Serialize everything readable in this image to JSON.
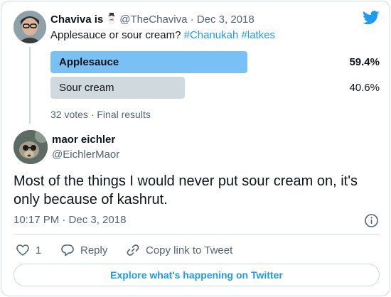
{
  "parent_tweet": {
    "author_name": "Chaviva is",
    "author_emoji": "snowman-emoji",
    "handle": "@TheChaviva",
    "separator": "·",
    "date": "Dec 3, 2018",
    "text_prefix": "Applesauce or sour cream? ",
    "hashtags": [
      "#Chanukah",
      "#latkes"
    ],
    "poll": {
      "options": [
        {
          "label": "Applesauce",
          "percent_text": "59.4%",
          "percent": 59.4,
          "winner": true
        },
        {
          "label": "Sour cream",
          "percent_text": "40.6%",
          "percent": 40.6,
          "winner": false
        }
      ],
      "meta": "32 votes · Final results"
    }
  },
  "reply_tweet": {
    "author_name": "maor eichler",
    "handle": "@EichlerMaor",
    "text": "Most of the things I would never put sour cream on, it's only because of kashrut.",
    "timestamp": "10:17 PM · Dec 3, 2018"
  },
  "actions": {
    "like_count": "1",
    "reply_label": "Reply",
    "copy_label": "Copy link to Tweet"
  },
  "explore_label": "Explore what's happening on Twitter",
  "colors": {
    "accent": "#1d9bf0",
    "poll_winner": "#79c1f5",
    "poll_other": "#cfd9de",
    "muted_text": "#536471"
  },
  "icons": [
    "twitter-logo-icon",
    "heart-icon",
    "reply-icon",
    "link-icon",
    "info-icon"
  ]
}
